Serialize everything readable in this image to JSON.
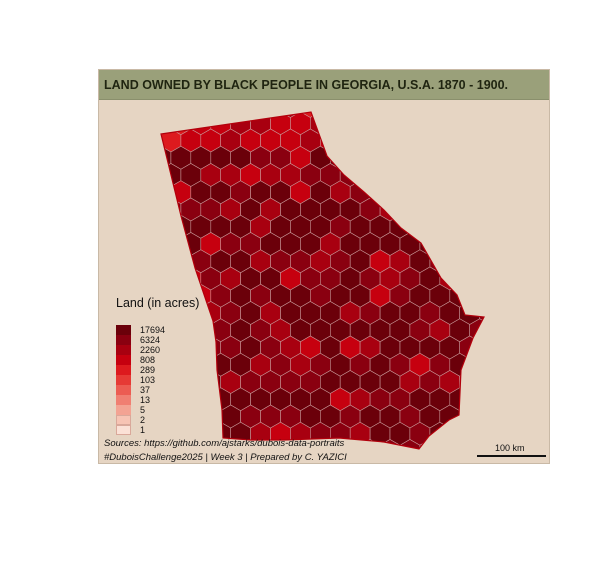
{
  "title": "LAND OWNED BY BLACK PEOPLE IN GEORGIA, U.S.A. 1870 - 1900.",
  "colors": {
    "background": "#e6d5c3",
    "title_bar": "#9aa07a",
    "hex_border": "#c99a9a",
    "dark_red": "#7a000d",
    "red": "#c8000f",
    "light_red": "#f7c6b8"
  },
  "legend": {
    "title": "Land (in acres)",
    "items": [
      {
        "label": "17694",
        "color": "#6b000a"
      },
      {
        "label": "6324",
        "color": "#8a0010"
      },
      {
        "label": "2260",
        "color": "#a80010"
      },
      {
        "label": "808",
        "color": "#c6000f"
      },
      {
        "label": "289",
        "color": "#dd1a1e"
      },
      {
        "label": "103",
        "color": "#e63a35"
      },
      {
        "label": "37",
        "color": "#ec5c52"
      },
      {
        "label": "13",
        "color": "#f07f72"
      },
      {
        "label": "5",
        "color": "#f3a393"
      },
      {
        "label": "2",
        "color": "#f7c4b4"
      },
      {
        "label": "1",
        "color": "#fbe1d6"
      }
    ]
  },
  "sources": "Sources: https://github.com/ajstarks/dubois-data-portraits",
  "credit": "#DuboisChallenge2025 | Week 3 | Prepared by C. YAZICI",
  "scale_bar": {
    "label": "100 km"
  }
}
